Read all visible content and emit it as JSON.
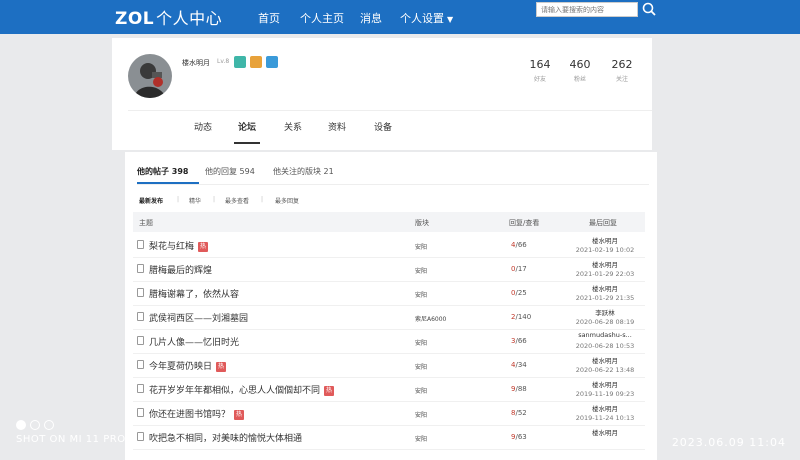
{
  "topbar": {
    "logo": "ZOL",
    "logo_sub": "个人中心",
    "nav": [
      "首页",
      "个人主页",
      "消息",
      "个人设置"
    ],
    "search_placeholder": "请输入要搜索的内容",
    "bg_color": "#1d6fc2"
  },
  "profile": {
    "username": "楼水明月",
    "level": "Lv.8",
    "badges": [
      {
        "icon": "star-badge-icon",
        "color": "#3fb6a8"
      },
      {
        "icon": "medal-badge-icon",
        "color": "#e8a23a"
      },
      {
        "icon": "drop-badge-icon",
        "color": "#3a9ad9"
      }
    ],
    "stats": [
      {
        "value": "164",
        "label": "好友"
      },
      {
        "value": "460",
        "label": "粉丝"
      },
      {
        "value": "262",
        "label": "关注"
      }
    ],
    "tabs": [
      "动态",
      "论坛",
      "关系",
      "资料",
      "设备"
    ],
    "active_tab": "论坛"
  },
  "forum": {
    "tabs": [
      "他的帖子 398",
      "他的回复 594",
      "他关注的版块 21"
    ],
    "sort": [
      "最新发布",
      "精华",
      "最多查看",
      "最多回复"
    ],
    "headers": {
      "title": "主题",
      "board": "版块",
      "stats": "回复/查看",
      "last": "最后回复"
    },
    "rows": [
      {
        "title": "梨花与红梅",
        "hot": true,
        "board": "安阳",
        "replies": "4",
        "views": "66",
        "last_user": "楼水明月",
        "last_time": "2021-02-19 10:02"
      },
      {
        "title": "腊梅最后的辉煌",
        "hot": false,
        "board": "安阳",
        "replies": "0",
        "views": "17",
        "last_user": "楼水明月",
        "last_time": "2021-01-29 22:03"
      },
      {
        "title": "腊梅谢幕了，依然从容",
        "hot": false,
        "board": "安阳",
        "replies": "0",
        "views": "25",
        "last_user": "楼水明月",
        "last_time": "2021-01-29 21:35"
      },
      {
        "title": "武侯祠西区——刘湘墓园",
        "hot": false,
        "board": "索尼A6000",
        "replies": "2",
        "views": "140",
        "last_user": "李跃林",
        "last_time": "2020-06-28 08:19"
      },
      {
        "title": "几片人像——忆旧时光",
        "hot": false,
        "board": "安阳",
        "replies": "3",
        "views": "66",
        "last_user": "sanmudashu-s...",
        "last_time": "2020-06-28 10:53"
      },
      {
        "title": "今年夏荷仍映日",
        "hot": true,
        "board": "安阳",
        "replies": "4",
        "views": "34",
        "last_user": "楼水明月",
        "last_time": "2020-06-22 13:48"
      },
      {
        "title": "花开岁岁年年都相似，心思人人個個却不同",
        "hot": true,
        "board": "安阳",
        "replies": "9",
        "views": "88",
        "last_user": "楼水明月",
        "last_time": "2019-11-19 09:23"
      },
      {
        "title": "你还在进图书馆吗？",
        "hot": true,
        "board": "安阳",
        "replies": "8",
        "views": "52",
        "last_user": "楼水明月",
        "last_time": "2019-11-24 10:13"
      },
      {
        "title": "吹把急不相同，对美味的愉悦大体相通",
        "hot": false,
        "board": "安阳",
        "replies": "9",
        "views": "63",
        "last_user": "楼水明月",
        "last_time": ""
      }
    ],
    "hot_label": "热"
  },
  "watermark": {
    "device": "SHOT ON MI 11 PRO",
    "datetime": "2023.06.09   11:04"
  }
}
